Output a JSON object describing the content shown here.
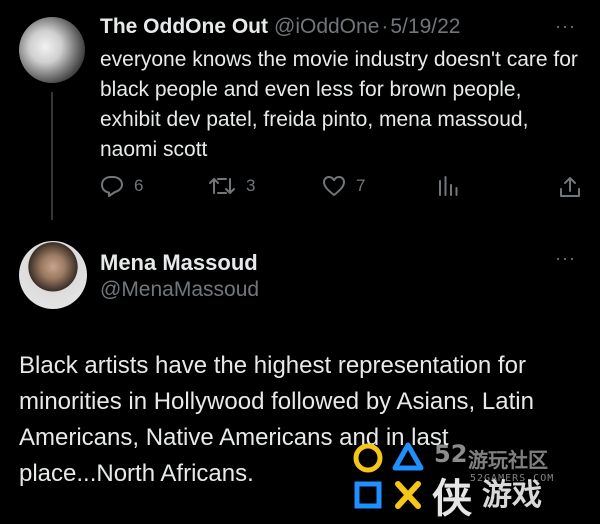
{
  "tweet1": {
    "display_name": "The OddOne Out",
    "handle": "@iOddOne",
    "separator": "·",
    "date": "5/19/22",
    "text": "everyone knows the movie industry doesn't care for black people and even less for brown people, exhibit dev patel, freida pinto, mena massoud, naomi scott",
    "actions": {
      "replies": "6",
      "retweets": "3",
      "likes": "7"
    },
    "more_icon": "···"
  },
  "tweet2": {
    "display_name": "Mena Massoud",
    "handle": "@MenaMassoud",
    "more_icon": "···",
    "text": "Black artists have the highest representation for minorities in Hollywood followed by Asians, Latin Americans, Native Americans and in last place...North Africans."
  },
  "colors": {
    "background": "#000000",
    "primary_text": "#e7e9ea",
    "secondary_text": "#71767b",
    "thread_line": "#333639",
    "watermark_yellow": "#f5c518",
    "watermark_blue": "#1e90ff"
  },
  "icons": {
    "reply": "reply-icon",
    "retweet": "retweet-icon",
    "like": "heart-icon",
    "views": "views-icon",
    "share": "share-icon"
  },
  "watermark": {
    "number": "52",
    "line1": "游玩社区",
    "site": "52GAMERS.COM",
    "char": "侠",
    "line2": "游戏"
  }
}
